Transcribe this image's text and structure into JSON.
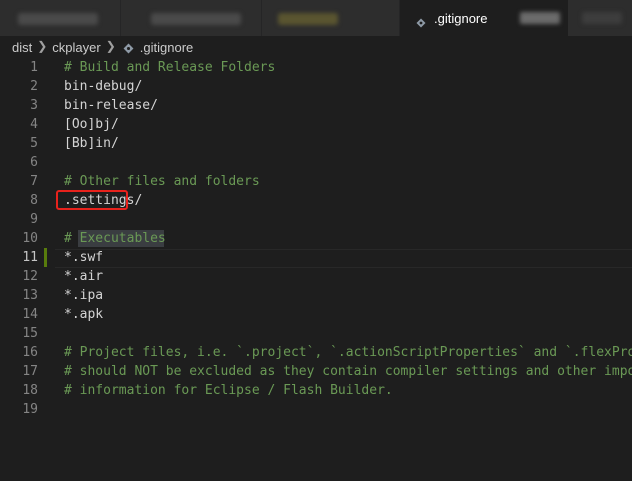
{
  "tabs": {
    "active_label": ".gitignore"
  },
  "breadcrumb": {
    "items": [
      "dist",
      "ckplayer",
      ".gitignore"
    ]
  },
  "editor": {
    "lines": [
      {
        "num": "1",
        "text": "# Build and Release Folders",
        "type": "comment"
      },
      {
        "num": "2",
        "text": "bin-debug/",
        "type": "plain"
      },
      {
        "num": "3",
        "text": "bin-release/",
        "type": "plain"
      },
      {
        "num": "4",
        "text": "[Oo]bj/",
        "type": "plain"
      },
      {
        "num": "5",
        "text": "[Bb]in/",
        "type": "plain"
      },
      {
        "num": "6",
        "text": "",
        "type": "plain"
      },
      {
        "num": "7",
        "text": "# Other files and folders",
        "type": "comment"
      },
      {
        "num": "8",
        "text": ".settings/",
        "type": "plain"
      },
      {
        "num": "9",
        "text": "",
        "type": "plain"
      },
      {
        "num": "10",
        "text": "# Executables",
        "type": "comment"
      },
      {
        "num": "11",
        "text": "*.swf",
        "type": "plain"
      },
      {
        "num": "12",
        "text": "*.air",
        "type": "plain"
      },
      {
        "num": "13",
        "text": "*.ipa",
        "type": "plain"
      },
      {
        "num": "14",
        "text": "*.apk",
        "type": "plain"
      },
      {
        "num": "15",
        "text": "",
        "type": "plain"
      },
      {
        "num": "16",
        "text": "# Project files, i.e. `.project`, `.actionScriptProperties` and `.flexProp",
        "type": "comment"
      },
      {
        "num": "17",
        "text": "# should NOT be excluded as they contain compiler settings and other impor",
        "type": "comment"
      },
      {
        "num": "18",
        "text": "# information for Eclipse / Flash Builder.",
        "type": "comment"
      },
      {
        "num": "19",
        "text": "",
        "type": "plain"
      }
    ],
    "active_line": 11,
    "modified_line": 11,
    "highlighted_line": 10
  },
  "colors": {
    "comment": "#6a9955",
    "plain": "#d4d4d4",
    "annotation_box": "#e8221c",
    "gutter_modified": "#587c0c"
  },
  "icons": {
    "file": "gitignore-file-icon",
    "separator": "chevron-right-icon"
  }
}
